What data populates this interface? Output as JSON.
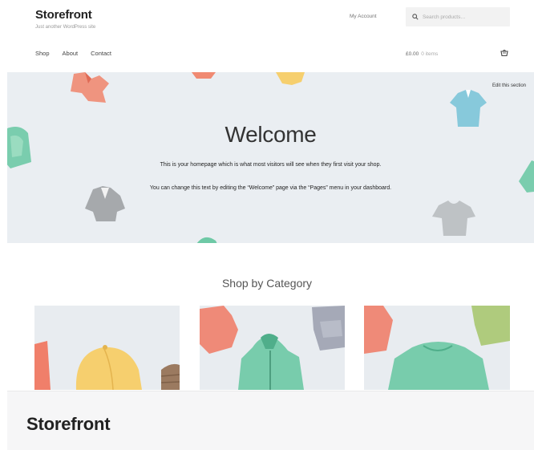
{
  "header": {
    "brand_title": "Storefront",
    "brand_tagline": "Just another WordPress site",
    "my_account": "My Account",
    "search_placeholder": "Search products…",
    "nav": [
      "Shop",
      "About",
      "Contact"
    ],
    "cart_total": "£0.00",
    "cart_items": "0 items"
  },
  "hero": {
    "edit_section": "Edit this section",
    "title": "Welcome",
    "line1": "This is your homepage which is what most visitors will see when they first visit your shop.",
    "line2": "You can change this text by editing the “Welcome” page via the “Pages” menu in your dashboard."
  },
  "category": {
    "heading": "Shop by Category"
  },
  "footer": {
    "title": "Storefront"
  },
  "colors": {
    "hero_bg": "#eaeef2",
    "footer_bg": "#f6f6f7"
  },
  "icons": [
    "search-icon",
    "cart-icon"
  ]
}
